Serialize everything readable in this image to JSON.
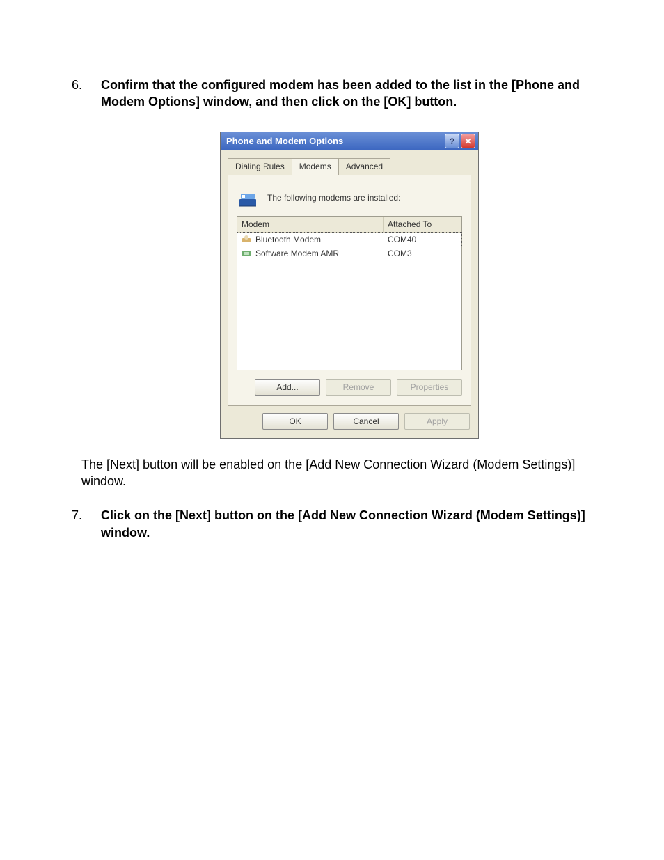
{
  "steps": {
    "s6": "Confirm that the configured modem has been added to the list in the [Phone and Modem Options] window, and then click on the [OK] button.",
    "mid": "The [Next] button will be enabled on the [Add New Connection Wizard (Modem Settings)] window.",
    "s7": "Click on the [Next] button on the [Add New Connection Wizard (Modem Settings)] window."
  },
  "dialog": {
    "title": "Phone and Modem Options",
    "help": "?",
    "close": "✕",
    "tabs": {
      "t1": "Dialing Rules",
      "t2": "Modems",
      "t3": "Advanced"
    },
    "message": "The following modems are installed:",
    "headers": {
      "modem": "Modem",
      "attached": "Attached To"
    },
    "rows": [
      {
        "name": "Bluetooth Modem",
        "port": "COM40",
        "selected": true,
        "icon": "bt"
      },
      {
        "name": "Software Modem AMR",
        "port": "COM3",
        "selected": false,
        "icon": "sw"
      }
    ],
    "buttons": {
      "add": "Add...",
      "remove": "Remove",
      "properties": "Properties",
      "ok": "OK",
      "cancel": "Cancel",
      "apply": "Apply"
    }
  }
}
